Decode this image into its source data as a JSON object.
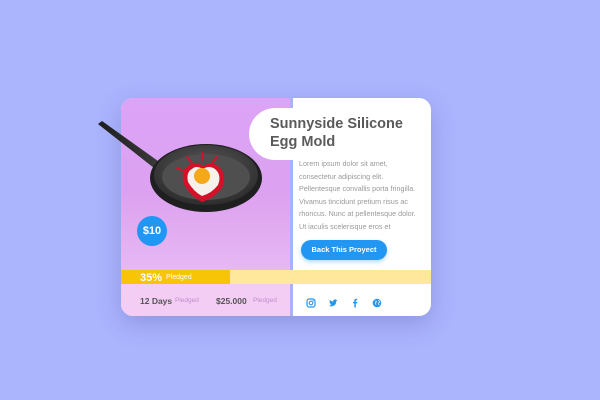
{
  "campaign": {
    "title": "Sunnyside Silicone Egg Mold",
    "description": "Lorem ipsum dolor sit amet,\nconsectetur adipiscing elit.\nPellentesque convallis porta fringilla.\nVivamus tincidunt pretium risus ac\nrhoncus. Nunc at pellentesque dolor.\nUt iaculis scelerisque eros et",
    "price": "$10",
    "cta_label": "Back This Proyect"
  },
  "progress": {
    "percent_label": "35%",
    "pledged_label": "Pledged",
    "fraction": 0.35
  },
  "stats": {
    "days_value": "12 Days",
    "days_label": "Pledged",
    "amount_value": "$25.000",
    "amount_label": "Pledged"
  },
  "social": {
    "icons": [
      "instagram-icon",
      "twitter-icon",
      "facebook-icon",
      "globe-icon"
    ]
  },
  "colors": {
    "background": "#abb5fd",
    "accent": "#2196f3",
    "progress": "#f8c406",
    "progress_track": "#ffe79b",
    "image_bg": "#dca3f7"
  }
}
